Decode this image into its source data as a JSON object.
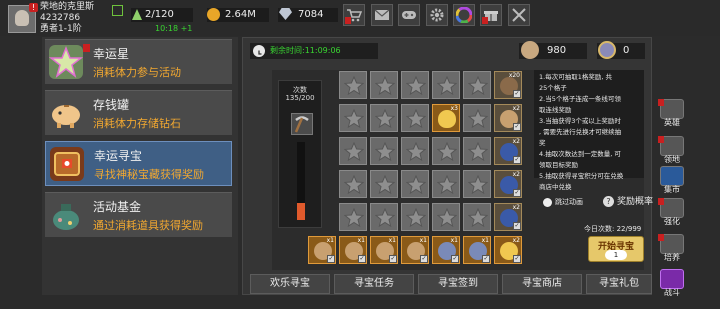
{
  "player": {
    "name": "荣地的克里斯",
    "id": "4232786",
    "rank": "勇者1-1阶"
  },
  "stats": {
    "energy": "2/120",
    "regen": "10:18 +1",
    "gold": "2.64M",
    "gems": "7084"
  },
  "top_icons": [
    "shop-icon",
    "mail-icon",
    "gamepad-icon",
    "settings-icon",
    "color-wheel-icon",
    "gift-icon",
    "swords-icon"
  ],
  "left_menu": [
    {
      "title": "幸运星",
      "desc": "消耗体力参与活动",
      "icon": "star-icon",
      "selected": false
    },
    {
      "title": "存钱罐",
      "desc": "消耗体力存储钻石",
      "icon": "piggy-bank-icon",
      "selected": false
    },
    {
      "title": "幸运寻宝",
      "desc": "寻找神秘宝藏获得奖励",
      "icon": "treasure-icon",
      "selected": true
    },
    {
      "title": "活动基金",
      "desc": "通过消耗道具获得奖励",
      "icon": "money-bag-icon",
      "selected": false
    }
  ],
  "timer": {
    "label": "剩余时间:",
    "value": "11:09:06"
  },
  "resources": {
    "pickaxes": "980",
    "tokens": "0"
  },
  "counter": {
    "label": "次数",
    "value": "135/200",
    "fill": 0.22
  },
  "info_lines": [
    "1.每次可抽取1格奖励, 共",
    "25个格子",
    "2.当5个格子连成一条线可领",
    "取连线奖励",
    "3.当抽获得3个或以上奖励时",
    ", 需要先进行兑换才可继续抽",
    "奖",
    "4.抽取次数达到一定数量, 可",
    "领取目标奖励",
    "5.抽取获得寻宝积分可在兑换",
    "商店中兑换"
  ],
  "skip_label": "跳过动画",
  "probability_label": "奖励概率",
  "today_count": {
    "label": "今日次数:",
    "value": "22/999"
  },
  "start": {
    "label": "开始寻宝",
    "cost": "1"
  },
  "tabs": [
    "欢乐寻宝",
    "寻宝任务",
    "寻宝签到",
    "寻宝商店",
    "寻宝礼包"
  ],
  "nav": [
    "英雄",
    "领地",
    "集市",
    "强化",
    "培养",
    "战斗"
  ],
  "rewards_right": [
    "x20",
    "x2",
    "x2",
    "x2",
    "x2",
    "x2"
  ],
  "rewards_bottom": [
    "x1",
    "x1",
    "x1",
    "x1",
    "x1",
    "x1",
    "x2"
  ],
  "grid_egg_count": "x3"
}
